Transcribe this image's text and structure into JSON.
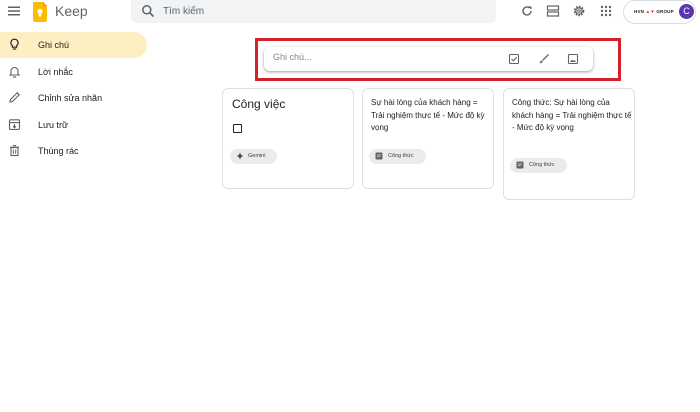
{
  "app": {
    "title": "Keep"
  },
  "search": {
    "placeholder": "Tìm kiếm"
  },
  "header": {
    "brand": {
      "left": "HVN",
      "right": "GROUP"
    },
    "avatar_initial": "C"
  },
  "sidebar": {
    "items": [
      {
        "label": "Ghi chú",
        "icon": "lightbulb-icon",
        "active": true
      },
      {
        "label": "Lời nhắc",
        "icon": "bell-icon",
        "active": false
      },
      {
        "label": "Chỉnh sửa nhãn",
        "icon": "pencil-icon",
        "active": false
      },
      {
        "label": "Lưu trữ",
        "icon": "archive-icon",
        "active": false
      },
      {
        "label": "Thùng rác",
        "icon": "trash-icon",
        "active": false
      }
    ]
  },
  "composer": {
    "placeholder": "Ghi chú..."
  },
  "notes": [
    {
      "title": "Công việc",
      "label": "Gemini"
    },
    {
      "text": "Sự hài lòng của khách hàng = Trải nghiệm thực tế - Mức độ kỳ vọng",
      "label": "Công thức"
    },
    {
      "text": "Công thức: Sự hài lòng của khách hàng = Trải nghiệm thực tế  - Mức độ kỳ vọng",
      "label": "Công thức"
    }
  ],
  "colors": {
    "active_nav": "#feefc3",
    "highlight_border": "#d3202b",
    "keep_yellow": "#fbbc04",
    "avatar": "#5e35b1"
  }
}
